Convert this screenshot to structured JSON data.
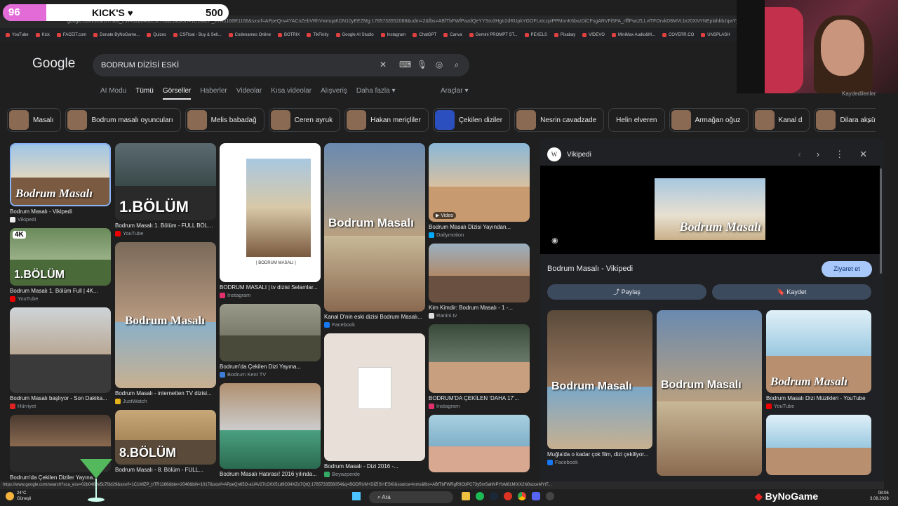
{
  "browser": {
    "url": "google.com/search?sca_esv=02b0482e5c7f3d29&sxsrf=1C1MlZP_trTR1166R1166&sxsrf=APpeQnv4YACnZebVRhVwmqaKDN10yEEZMg:1785733552088&udm=2&fbs=ABfTbFWfPazdQeYYSro3Hgtr2dRUpkYGOFLxtczpiPPMonK6bxzDiCFsgARVFi5PA_rfffFwcZLLvlTFOrvkD8MVLbr20XNYNEplahkbJqwYyNKQ7WbE",
    "bookmarks": [
      "YouTube",
      "Kick",
      "FACEIT.com",
      "Donate ByNoGame...",
      "Quizes",
      "CSFloat - Buy & Sell...",
      "Codenames Online",
      "BOTRIX",
      "TikFinity",
      "Google AI Studio",
      "Instagram",
      "ChatGPT",
      "Canva",
      "Gemini PROMPT ST...",
      "PEXELS",
      "Pixabay",
      "VİDEVO",
      "MiniMax Audio&M...",
      "COVERR.CO",
      "UNSPLASH"
    ],
    "status_url": "https://www.google.com/search?sca_esv=02b0482e5c7f3d29&sxsrf=1C1MlZP_trTR1166&biw=2048&bih=1017&sxsrf=APpeQn65O-aUAV27cG0X5Ld9O34XZo7QtQ:1785733556054&q=BODRUM+DİZİSİ+ESKİ&source=lnms&fbs=ABfTbFWRgR9CbPC73y5mSahNPYbM81MIXX2N0szceMYtT..."
  },
  "overlay": {
    "level": "96",
    "name": "KICK'S",
    "heart": "♥",
    "score": "500"
  },
  "google": {
    "logo": "Google",
    "query": "BODRUM DİZİSİ ESKİ",
    "tabs": [
      "AI Modu",
      "Tümü",
      "Görseller",
      "Haberler",
      "Videolar",
      "Kısa videolar",
      "Alışveriş",
      "Daha fazla ▾"
    ],
    "tools": "Araçlar ▾"
  },
  "chips": [
    "Masalı",
    "Bodrum masalı oyuncuları",
    "Melis babadağ",
    "Ceren ayruk",
    "Hakan meriçliler",
    "Çekilen diziler",
    "Nesrin cavadzade",
    "Helin elveren",
    "Armağan oğuz",
    "Kanal d",
    "Dilara aksüyek",
    "Cem"
  ],
  "results": {
    "col1": [
      {
        "title": "Bodrum Masalı - Vikipedi",
        "source": "Vikipedi",
        "badge": "W",
        "color": "#eee"
      },
      {
        "title": "Bodrum Masalı 1. Bölüm Full | 4K...",
        "source": "YouTube",
        "badge": "▶",
        "color": "#e00"
      },
      {
        "title": "Bodrum Masalı başlıyor - Son Dakika...",
        "source": "Hürriyet",
        "badge": "H",
        "color": "#d22"
      },
      {
        "title": "Bodrum'da Çekilen Diziler Yayına...",
        "source": "",
        "badge": "",
        "color": "#fff"
      }
    ],
    "col2": [
      {
        "title": "Bodrum Masalı 1. Bölüm - FULL BÖLÜ...",
        "source": "YouTube",
        "color": "#e00"
      },
      {
        "title": "Bodrum Masalı - internetten TV dizisi...",
        "source": "JustWatch",
        "color": "#e5b31d"
      },
      {
        "title": "Bodrum Masalı - 8. Bölüm - FULL...",
        "source": "",
        "color": "#e00"
      }
    ],
    "col3": [
      {
        "title": "BODRUM MASALI | tv dizisi Selamlar...",
        "source": "Instagram",
        "color": "#e1306c"
      },
      {
        "title": "Bodrum'da Çekilen Dizi Yayına...",
        "source": "Bodrum Kent TV",
        "color": "#3b7dd8"
      },
      {
        "title": "Bodrum Masalı Hatırası! 2016 yılında...",
        "source": "",
        "color": "#e00"
      }
    ],
    "col4": [
      {
        "title": "Kanal D'nin eski dizisi Bodrum Masalı...",
        "source": "Facebook",
        "color": "#1877f2"
      },
      {
        "title": "Bodrum Masalı - Dizi 2016 -...",
        "source": "Beyazperde",
        "color": "#3a6"
      }
    ],
    "col5": [
      {
        "title": "Bodrum Masalı Dizisi Yayından...",
        "source": "Dailymotion",
        "color": "#0af"
      },
      {
        "title": "Kim Kimdir: Bodrum Masalı - 1 -...",
        "source": "Ranini.tv",
        "color": "#ddd"
      },
      {
        "title": "BODRUM'DA ÇEKİLEN 'DAHA 17'...",
        "source": "Instagram",
        "color": "#e1306c"
      }
    ]
  },
  "labels": {
    "video": "▶ Video",
    "bolum": "1.BÖLÜM",
    "bolum8": "8.BÖLÜM",
    "bm": "Bodrum Masalı",
    "bm2": "Bodrum\nMasalı",
    "k4": "4K",
    "poster_caption": "| BODRUM MASALI |"
  },
  "panel": {
    "source": "Vikipedi",
    "title": "Bodrum Masalı - Vikipedi",
    "visit": "Ziyaret et",
    "share": "Paylaş",
    "save": "Kaydet",
    "related": [
      {
        "title": "Muğla'da o kadar çok film, dizi çekiliyor...",
        "source": "Facebook"
      },
      {
        "title": "",
        "source": ""
      },
      {
        "title": "Bodrum Masalı Dizi Müzikleri - YouTube",
        "source": "YouTube"
      }
    ]
  },
  "taskbar": {
    "temp": "24°C",
    "weather": "Güneşli",
    "search": "Ara",
    "brand": "ByNoGame",
    "time": "08:06",
    "date": "3.08.2026"
  },
  "webcam_caption": "Kaydedilenler"
}
